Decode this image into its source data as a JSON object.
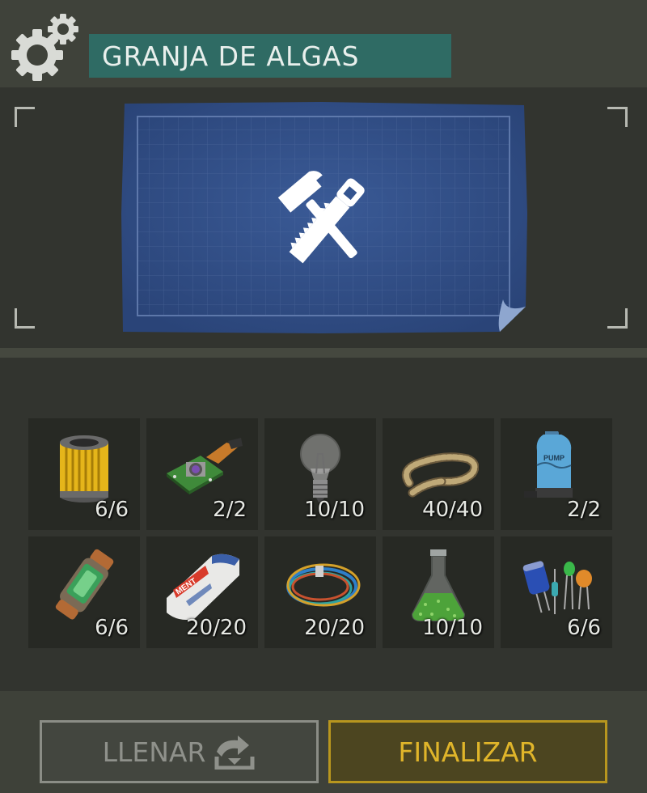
{
  "header": {
    "title": "GRANJA DE ALGAS",
    "settings_icon": "gears-icon"
  },
  "preview": {
    "icon": "hammer-saw-icon",
    "background": "blueprint"
  },
  "items": [
    {
      "name": "filter",
      "icon": "air-filter-icon",
      "count": "6/6"
    },
    {
      "name": "circuit-board",
      "icon": "circuit-board-icon",
      "count": "2/2"
    },
    {
      "name": "light-bulb",
      "icon": "light-bulb-icon",
      "count": "10/10"
    },
    {
      "name": "rope",
      "icon": "rope-icon",
      "count": "40/40"
    },
    {
      "name": "pump",
      "icon": "pump-icon",
      "count": "2/2"
    },
    {
      "name": "canister",
      "icon": "canister-icon",
      "count": "6/6"
    },
    {
      "name": "cement",
      "icon": "cement-bag-icon",
      "count": "20/20"
    },
    {
      "name": "wires",
      "icon": "wires-icon",
      "count": "20/20"
    },
    {
      "name": "chemical",
      "icon": "flask-icon",
      "count": "10/10"
    },
    {
      "name": "electronics",
      "icon": "capacitor-icon",
      "count": "6/6"
    }
  ],
  "item_labels": {
    "pump_text": "PUMP",
    "cement_text": "MENT"
  },
  "buttons": {
    "fill_label": "LLENAR",
    "finish_label": "FINALIZAR"
  },
  "colors": {
    "title_bar": "#2f6b64",
    "finish_accent": "#e0b52a"
  }
}
